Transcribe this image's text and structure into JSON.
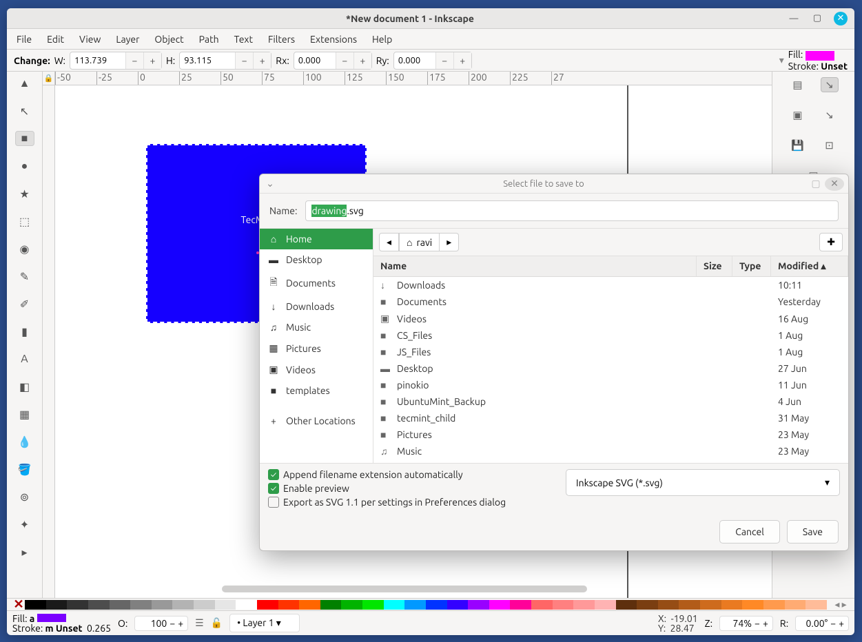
{
  "window": {
    "title": "*New document 1 - Inkscape"
  },
  "menubar": [
    "File",
    "Edit",
    "View",
    "Layer",
    "Object",
    "Path",
    "Text",
    "Filters",
    "Extensions",
    "Help"
  ],
  "tooloptions": {
    "change_label": "Change:",
    "w_label": "W:",
    "w": "113.739",
    "h_label": "H:",
    "h": "93.115",
    "rx_label": "Rx:",
    "rx": "0.000",
    "ry_label": "Ry:",
    "ry": "0.000",
    "fill_label": "Fill:",
    "stroke_label": "Stroke:",
    "fill_color": "#ff00ff",
    "stroke_value": "Unset"
  },
  "ruler_h": [
    "-50",
    "-25",
    "0",
    "25",
    "50",
    "75",
    "100",
    "125",
    "150",
    "175",
    "200",
    "225",
    "27"
  ],
  "canvas": {
    "rect_text": "TecMin"
  },
  "statusbar": {
    "fill_label": "Fill:",
    "fill_a": "a",
    "stroke_label": "Stroke:",
    "stroke_m": "m",
    "stroke_value": "Unset",
    "stroke_w": "0.265",
    "o_label": "O:",
    "opacity": "100",
    "layer": "Layer 1",
    "x_label": "X:",
    "x": "-19.01",
    "y_label": "Y:",
    "y": "28.47",
    "z_label": "Z:",
    "zoom": "74%",
    "r_label": "R:",
    "rotation": "0.00°"
  },
  "dialog": {
    "title": "Select file to save to",
    "name_label": "Name:",
    "filename_sel": "drawing",
    "filename_ext": ".svg",
    "breadcrumb_home": "ravi",
    "places": [
      {
        "label": "Home",
        "icon": "⌂",
        "active": true
      },
      {
        "label": "Desktop",
        "icon": "▬"
      },
      {
        "label": "Documents",
        "icon": "🗎"
      },
      {
        "label": "Downloads",
        "icon": "↓"
      },
      {
        "label": "Music",
        "icon": "♫"
      },
      {
        "label": "Pictures",
        "icon": "▦"
      },
      {
        "label": "Videos",
        "icon": "▣"
      },
      {
        "label": "templates",
        "icon": "■"
      },
      {
        "label": "Other Locations",
        "icon": "+"
      }
    ],
    "columns": {
      "name": "Name",
      "size": "Size",
      "type": "Type",
      "modified": "Modified"
    },
    "files": [
      {
        "icon": "↓",
        "name": "Downloads",
        "mod": "10:11"
      },
      {
        "icon": "■",
        "name": "Documents",
        "mod": "Yesterday"
      },
      {
        "icon": "▣",
        "name": "Videos",
        "mod": "16 Aug"
      },
      {
        "icon": "■",
        "name": "CS_Files",
        "mod": "1 Aug"
      },
      {
        "icon": "■",
        "name": "JS_Files",
        "mod": "1 Aug"
      },
      {
        "icon": "▬",
        "name": "Desktop",
        "mod": "27 Jun"
      },
      {
        "icon": "■",
        "name": "pinokio",
        "mod": "11 Jun"
      },
      {
        "icon": "■",
        "name": "UbuntuMint_Backup",
        "mod": "4 Jun"
      },
      {
        "icon": "■",
        "name": "tecmint_child",
        "mod": "31 May"
      },
      {
        "icon": "■",
        "name": "Pictures",
        "mod": "23 May"
      },
      {
        "icon": "♫",
        "name": "Music",
        "mod": "23 May"
      }
    ],
    "chk_append": "Append filename extension automatically",
    "chk_preview": "Enable preview",
    "chk_svg11": "Export as SVG 1.1 per settings in Preferences dialog",
    "filetype": "Inkscape SVG (*.svg)",
    "cancel": "Cancel",
    "save": "Save"
  },
  "palette": [
    "#000000",
    "#1a1a1a",
    "#333333",
    "#4d4d4d",
    "#666666",
    "#808080",
    "#999999",
    "#b3b3b3",
    "#cccccc",
    "#e6e6e6",
    "#ffffff",
    "#ff0000",
    "#ff3300",
    "#ff6600",
    "#008000",
    "#00b300",
    "#00e600",
    "#00ffff",
    "#0099ff",
    "#0033ff",
    "#3300ff",
    "#9900ff",
    "#ff00ff",
    "#ff0099",
    "#ff6666",
    "#ff8080",
    "#ff9999",
    "#ffb3b3",
    "#5e2f0d",
    "#7a3e11",
    "#964d15",
    "#b25c19",
    "#ce6b1d",
    "#ea7a21",
    "#ff8926",
    "#ff9a4d",
    "#ffab73",
    "#ffbc99"
  ]
}
